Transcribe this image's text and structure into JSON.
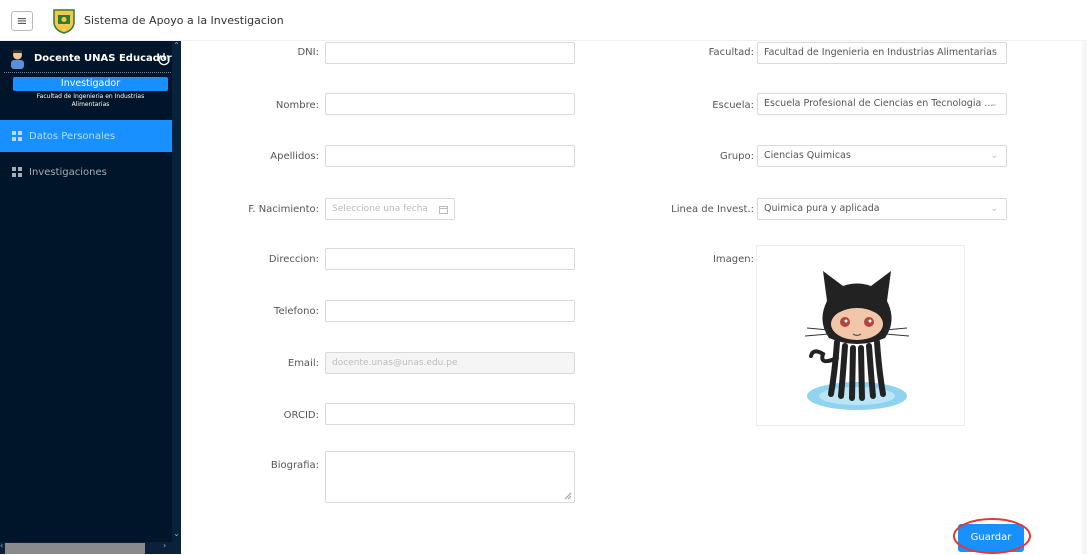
{
  "header": {
    "menu_icon": "hamburger-icon",
    "logo_icon": "university-logo",
    "title": "Sistema de Apoyo a la Investigacion"
  },
  "sidebar": {
    "user_name": "Docente UNAS Educador",
    "role": "Investigador",
    "faculty_line1": "Facultad de Ingenieria en Industrias",
    "faculty_line2": "Alimentarias",
    "items": [
      {
        "label": "Datos Personales",
        "icon": "grid-icon",
        "active": true
      },
      {
        "label": "Investigaciones",
        "icon": "grid-icon",
        "active": false
      }
    ]
  },
  "form": {
    "dni": {
      "label": "DNI",
      "value": ""
    },
    "nombre": {
      "label": "Nombre",
      "value": ""
    },
    "apellidos": {
      "label": "Apellidos",
      "value": ""
    },
    "nacimiento": {
      "label": "F. Nacimiento",
      "placeholder": "Seleccione una fecha"
    },
    "direccion": {
      "label": "Direccion",
      "value": ""
    },
    "telefono": {
      "label": "Telefono",
      "value": ""
    },
    "email": {
      "label": "Email",
      "value": "docente.unas@unas.edu.pe"
    },
    "orcid": {
      "label": "ORCID",
      "value": ""
    },
    "biografia": {
      "label": "Biografia",
      "value": ""
    },
    "facultad": {
      "label": "Facultad",
      "value": "Facultad de Ingenieria en Industrias Alimentarias"
    },
    "escuela": {
      "label": "Escuela",
      "value": "Escuela Profesional de Ciencias en Tecnologia ..."
    },
    "grupo": {
      "label": "Grupo",
      "value": "Ciencias Quimicas"
    },
    "linea": {
      "label": "Linea de Invest.",
      "value": "Quimica pura y aplicada"
    },
    "imagen": {
      "label": "Imagen",
      "image": "octocat"
    }
  },
  "actions": {
    "save_label": "Guardar"
  },
  "colors": {
    "sidebar_bg": "#001529",
    "accent": "#1890ff",
    "annotation": "#e53935"
  }
}
